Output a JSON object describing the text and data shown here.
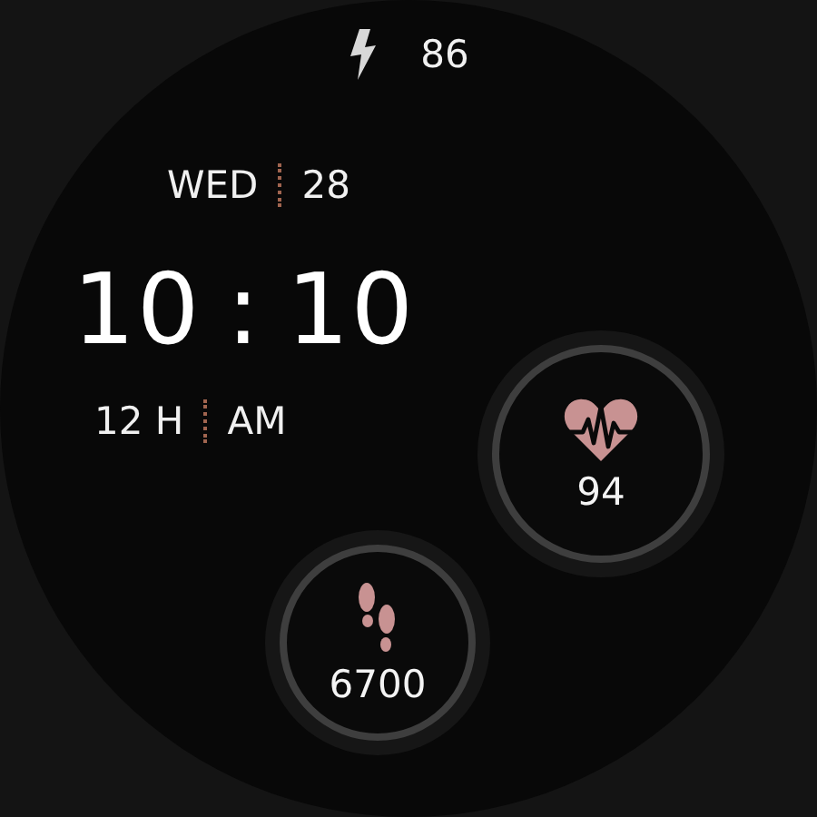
{
  "battery": {
    "value": "86"
  },
  "date": {
    "weekday": "WED",
    "day": "28"
  },
  "time": {
    "hours": "10",
    "separator": ":",
    "minutes": "10"
  },
  "hour_format": {
    "mode": "12 H",
    "period": "AM"
  },
  "complications": [
    {
      "kind": "heart",
      "value": "94"
    },
    {
      "kind": "steps",
      "value": "6700"
    }
  ]
}
